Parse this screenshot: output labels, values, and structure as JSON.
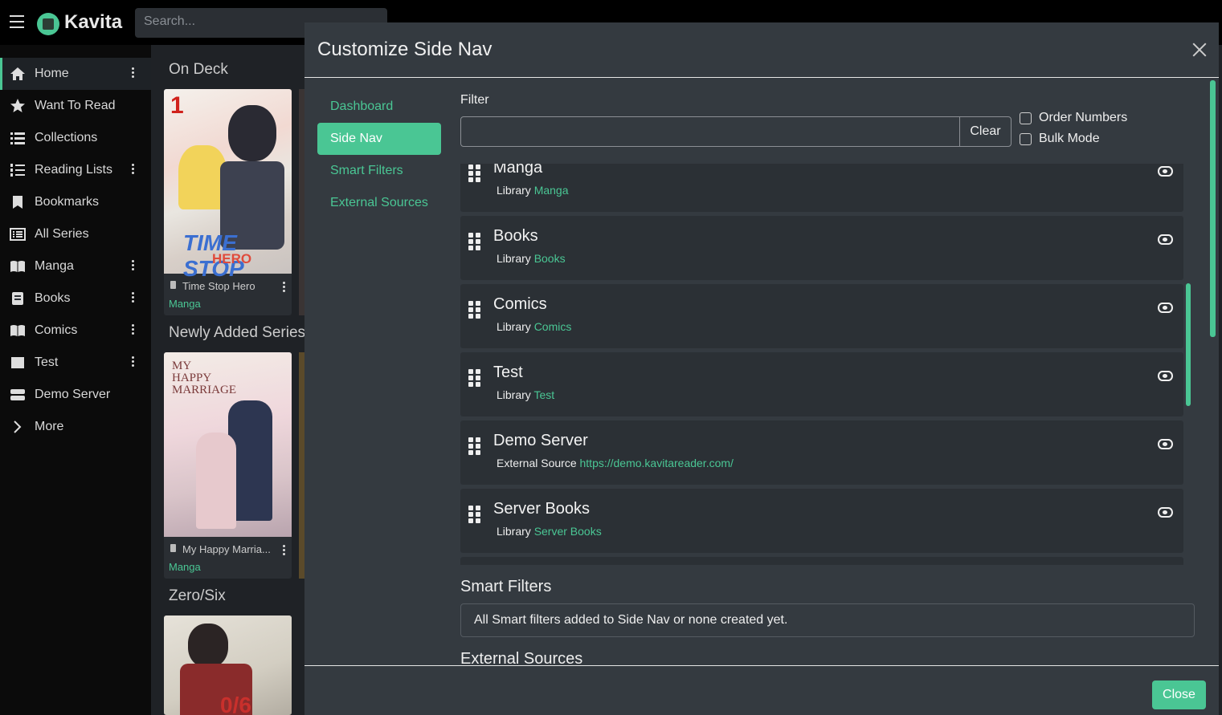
{
  "app": {
    "name": "Kavita",
    "search_placeholder": "Search..."
  },
  "sidebar": {
    "items": [
      {
        "label": "Home",
        "icon": "home-icon",
        "kebab": true
      },
      {
        "label": "Want To Read",
        "icon": "star-icon",
        "kebab": false
      },
      {
        "label": "Collections",
        "icon": "list-icon",
        "kebab": false
      },
      {
        "label": "Reading Lists",
        "icon": "ordered-list-icon",
        "kebab": true
      },
      {
        "label": "Bookmarks",
        "icon": "bookmark-icon",
        "kebab": false
      },
      {
        "label": "All Series",
        "icon": "table-list-icon",
        "kebab": false
      },
      {
        "label": "Manga",
        "icon": "book-open-icon",
        "kebab": true
      },
      {
        "label": "Books",
        "icon": "book-icon",
        "kebab": true
      },
      {
        "label": "Comics",
        "icon": "book-open-icon",
        "kebab": true
      },
      {
        "label": "Test",
        "icon": "image-icon",
        "kebab": true
      },
      {
        "label": "Demo Server",
        "icon": "server-icon",
        "kebab": false
      },
      {
        "label": "More",
        "icon": "chevron-right-icon",
        "kebab": false
      }
    ]
  },
  "dashboard": {
    "sections": [
      "On Deck",
      "Newly Added Series",
      "Zero/Six"
    ],
    "cards": [
      {
        "title": "Time Stop Hero",
        "library": "Manga"
      },
      {
        "title": "My Happy Marria...",
        "library": "Manga"
      }
    ]
  },
  "modal": {
    "title": "Customize Side Nav",
    "tabs": [
      "Dashboard",
      "Side Nav",
      "Smart Filters",
      "External Sources"
    ],
    "filter_label": "Filter",
    "filter_value": "",
    "clear_label": "Clear",
    "order_numbers_label": "Order Numbers",
    "bulk_mode_label": "Bulk Mode",
    "items": [
      {
        "name": "Manga",
        "type": "Library",
        "value": "Manga"
      },
      {
        "name": "Books",
        "type": "Library",
        "value": "Books"
      },
      {
        "name": "Comics",
        "type": "Library",
        "value": "Comics"
      },
      {
        "name": "Test",
        "type": "Library",
        "value": "Test"
      },
      {
        "name": "Demo Server",
        "type": "External Source",
        "value": "https://demo.kavitareader.com/"
      },
      {
        "name": "Server Books",
        "type": "Library",
        "value": "Server Books"
      }
    ],
    "smart_filters_heading": "Smart Filters",
    "smart_filters_note": "All Smart filters added to Side Nav or none created yet.",
    "external_sources_heading": "External Sources",
    "close_label": "Close"
  },
  "colors": {
    "accent": "#4ac694",
    "modal_bg": "#343a40",
    "item_bg": "#2b3035"
  }
}
